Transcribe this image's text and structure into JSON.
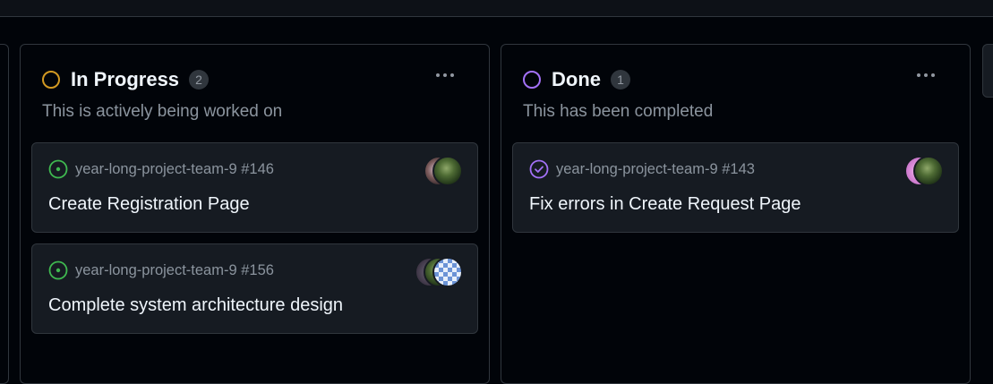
{
  "columns": [
    {
      "title": "In Progress",
      "count": "2",
      "description": "This is actively being worked on",
      "status_color": "#d29922",
      "cards": [
        {
          "repo": "year-long-project-team-9",
          "number": "#146",
          "title": "Create Registration Page",
          "state": "open"
        },
        {
          "repo": "year-long-project-team-9",
          "number": "#156",
          "title": "Complete system architecture design",
          "state": "open"
        }
      ]
    },
    {
      "title": "Done",
      "count": "1",
      "description": "This has been completed",
      "status_color": "#a371f7",
      "cards": [
        {
          "repo": "year-long-project-team-9",
          "number": "#143",
          "title": "Fix errors in Create Request Page",
          "state": "closed"
        }
      ]
    }
  ],
  "icons": {
    "open_issue": "issue-opened-icon",
    "closed_issue": "issue-closed-icon",
    "more": "kebab-horizontal-icon"
  },
  "colors": {
    "background": "#010409",
    "card": "#161b22",
    "border": "#30363d",
    "open": "#3fb950",
    "closed": "#a371f7"
  }
}
